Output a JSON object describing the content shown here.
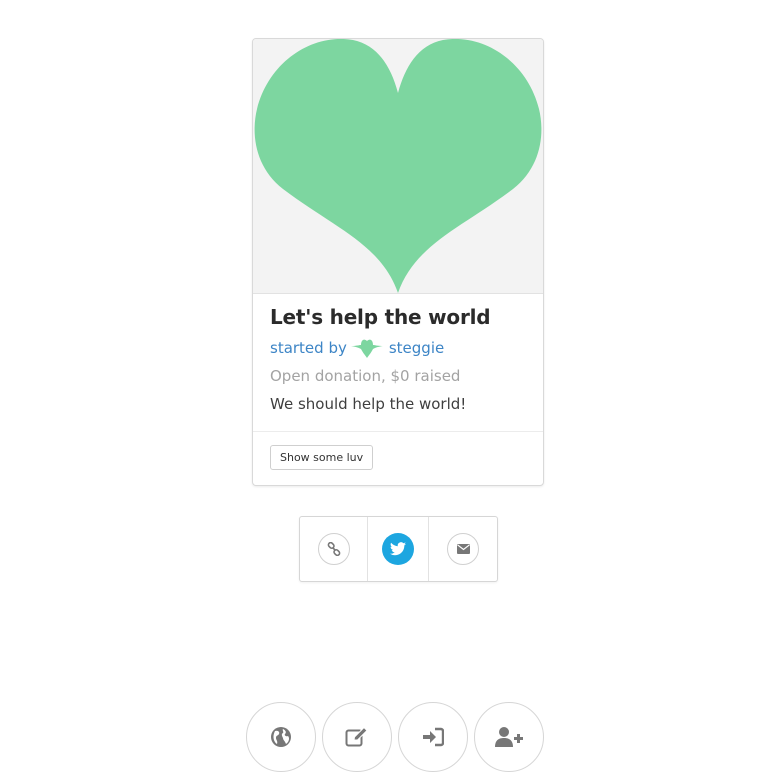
{
  "campaign": {
    "title": "Let's help the world",
    "byline_prefix": "started by",
    "author": "steggie",
    "meta": "Open donation, $0 raised",
    "description": "We should help the world!",
    "action_label": "Show some luv"
  },
  "share": {
    "icons": [
      "link-icon",
      "twitter-icon",
      "envelope-icon"
    ]
  },
  "bottom_nav": {
    "icons": [
      "globe-icon",
      "edit-icon",
      "sign-in-icon",
      "add-user-icon"
    ]
  },
  "colors": {
    "heart": "#7dd6a0",
    "link": "#3d85c6",
    "twitter": "#1da6e0",
    "icon_gray": "#777777"
  }
}
